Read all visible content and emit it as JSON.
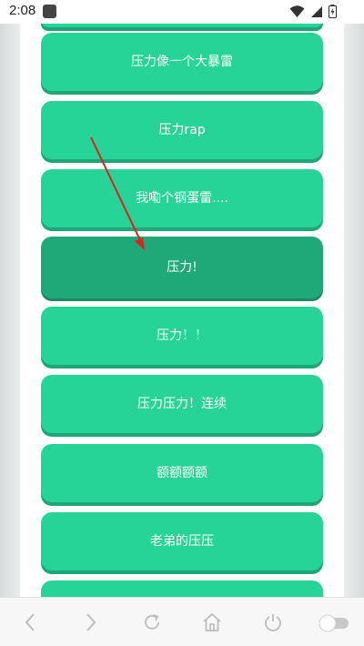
{
  "status_bar": {
    "time": "2:08",
    "icons": [
      "app-notification-icon",
      "wifi-icon",
      "signal-icon",
      "battery-charging-icon"
    ]
  },
  "buttons": [
    {
      "label": ""
    },
    {
      "label": "压力像一个大暴雷"
    },
    {
      "label": "压力rap"
    },
    {
      "label": "我嘞个钢蛋雷...."
    },
    {
      "label": "压力!"
    },
    {
      "label": "压力！！"
    },
    {
      "label": "压力压力！连续"
    },
    {
      "label": "额额额额"
    },
    {
      "label": "老弟的压压"
    },
    {
      "label": ""
    }
  ],
  "bottom_nav": {
    "items": [
      "back-icon",
      "forward-icon",
      "refresh-icon",
      "home-icon",
      "power-icon",
      "toggle-icon"
    ]
  },
  "colors": {
    "button": "#25d496",
    "button_pressed": "#1fa878",
    "arrow": "#e02020"
  }
}
